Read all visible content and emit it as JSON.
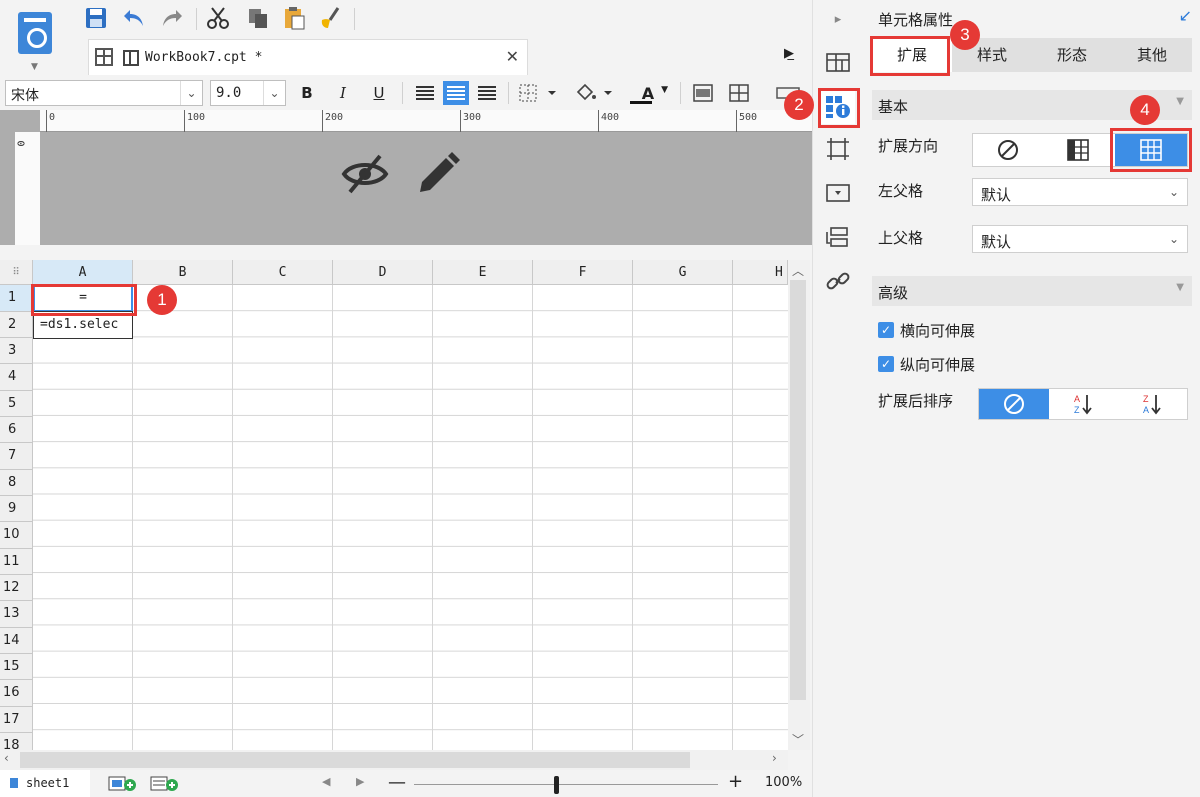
{
  "app": {
    "document_tab": "WorkBook7.cpt *"
  },
  "format_bar": {
    "font_name": "宋体",
    "font_size": "9.0",
    "bold": "B",
    "italic": "I",
    "underline": "U",
    "font_color_glyph": "A"
  },
  "ruler": {
    "ticks": [
      "0",
      "100",
      "200",
      "300",
      "400",
      "500"
    ],
    "left_zero": "0"
  },
  "sheet": {
    "columns": [
      "A",
      "B",
      "C",
      "D",
      "E",
      "F",
      "G",
      "H"
    ],
    "rows": [
      "1",
      "2",
      "3",
      "4",
      "5",
      "6",
      "7",
      "8",
      "9",
      "10",
      "11",
      "12",
      "13",
      "14",
      "15",
      "16",
      "17",
      "18"
    ],
    "selected_column": "A",
    "selected_row": "1",
    "cells": {
      "A1": "=",
      "A2": "=ds1.selec"
    }
  },
  "status": {
    "sheet_tab": "sheet1",
    "zoom_minus": "—",
    "zoom_plus": "+",
    "zoom": "100%",
    "zoom_fraction": 0.47
  },
  "props": {
    "title": "单元格属性",
    "tabs": [
      "扩展",
      "样式",
      "形态",
      "其他"
    ],
    "active_tab": "扩展",
    "basic": {
      "header": "基本",
      "expand_direction_label": "扩展方向",
      "expand_direction_selected": "vertical-grid",
      "left_parent_label": "左父格",
      "left_parent_value": "默认",
      "top_parent_label": "上父格",
      "top_parent_value": "默认"
    },
    "advanced": {
      "header": "高级",
      "horizontal_expand": "横向可伸展",
      "vertical_expand": "纵向可伸展",
      "sort_label": "扩展后排序"
    }
  },
  "callouts": [
    "1",
    "2",
    "3",
    "4"
  ],
  "colors": {
    "accent": "#3d8ee6",
    "callout": "#e53935"
  }
}
